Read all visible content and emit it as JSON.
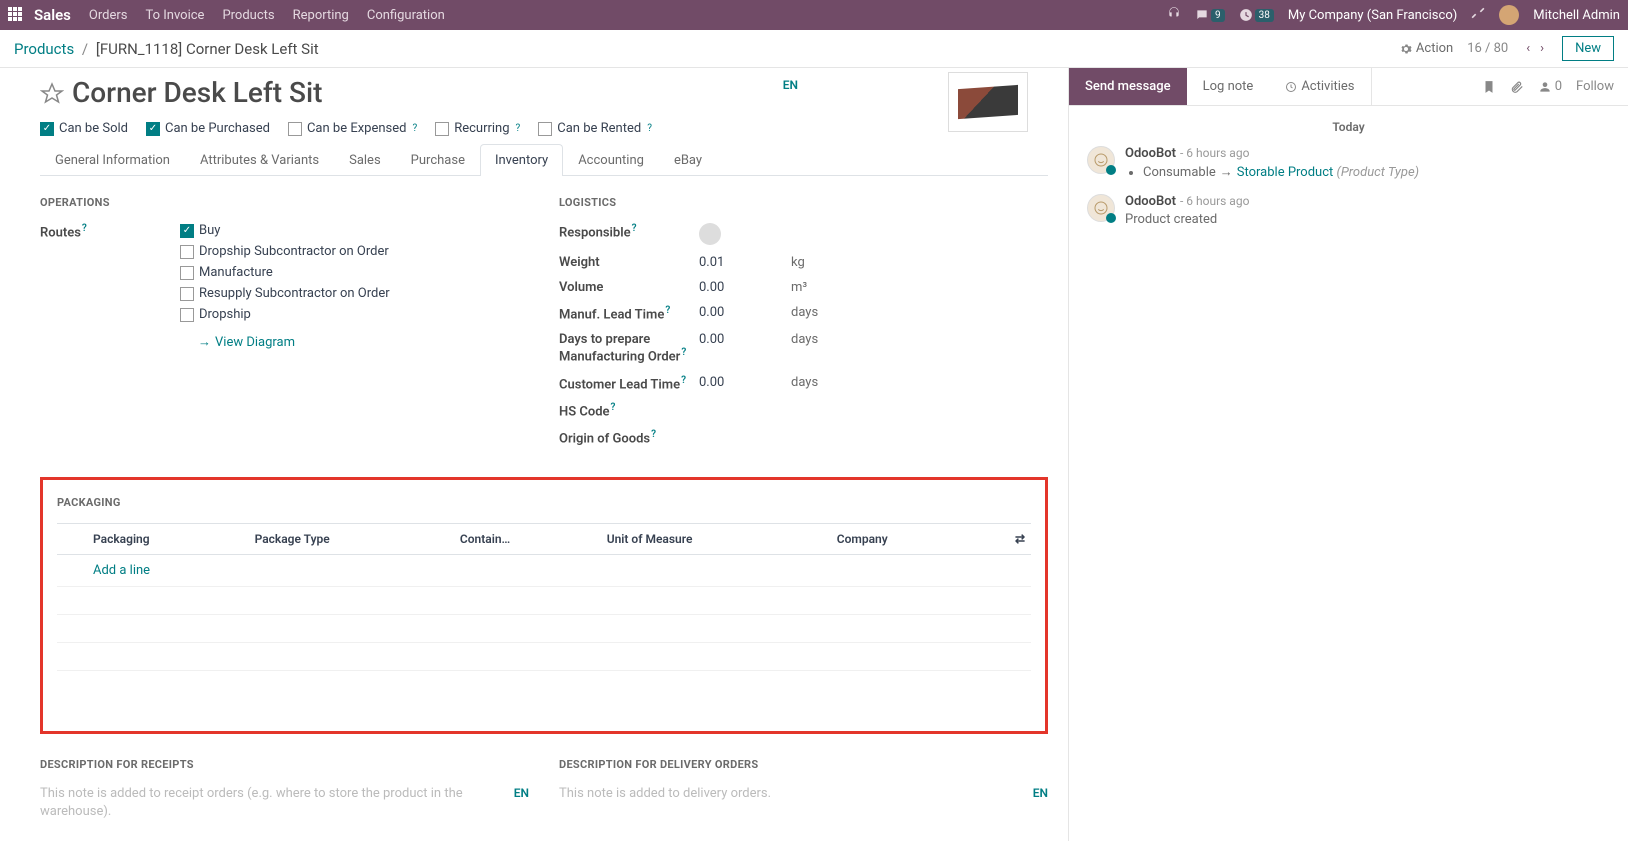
{
  "topbar": {
    "brand": "Sales",
    "menu": [
      "Orders",
      "To Invoice",
      "Products",
      "Reporting",
      "Configuration"
    ],
    "msg_badge": "9",
    "clock_badge": "38",
    "company": "My Company (San Francisco)",
    "user": "Mitchell Admin"
  },
  "breadcrumb": {
    "root": "Products",
    "current": "[FURN_1118] Corner Desk Left Sit"
  },
  "control": {
    "action": "Action",
    "pager": "16 / 80",
    "new": "New"
  },
  "title": "Corner Desk Left Sit",
  "lang": "EN",
  "checks": {
    "sold": "Can be Sold",
    "purchased": "Can be Purchased",
    "expensed": "Can be Expensed",
    "recurring": "Recurring",
    "rented": "Can be Rented"
  },
  "tabs": [
    "General Information",
    "Attributes & Variants",
    "Sales",
    "Purchase",
    "Inventory",
    "Accounting",
    "eBay"
  ],
  "active_tab": 4,
  "operations": {
    "title": "OPERATIONS",
    "routes_label": "Routes",
    "routes": [
      {
        "label": "Buy",
        "checked": true
      },
      {
        "label": "Dropship Subcontractor on Order",
        "checked": false
      },
      {
        "label": "Manufacture",
        "checked": false
      },
      {
        "label": "Resupply Subcontractor on Order",
        "checked": false
      },
      {
        "label": "Dropship",
        "checked": false
      }
    ],
    "view_diagram": "View Diagram"
  },
  "logistics": {
    "title": "LOGISTICS",
    "fields": {
      "responsible": "Responsible",
      "weight": "Weight",
      "weight_val": "0.01",
      "weight_unit": "kg",
      "volume": "Volume",
      "volume_val": "0.00",
      "volume_unit": "m³",
      "mlt": "Manuf. Lead Time",
      "mlt_val": "0.00",
      "mlt_unit": "days",
      "dpmo": "Days to prepare Manufacturing Order",
      "dpmo_val": "0.00",
      "dpmo_unit": "days",
      "clt": "Customer Lead Time",
      "clt_val": "0.00",
      "clt_unit": "days",
      "hs": "HS Code",
      "origin": "Origin of Goods"
    }
  },
  "packaging": {
    "title": "PACKAGING",
    "cols": [
      "Packaging",
      "Package Type",
      "Contain…",
      "Unit of Measure",
      "Company"
    ],
    "add_line": "Add a line"
  },
  "descriptions": {
    "receipts_title": "DESCRIPTION FOR RECEIPTS",
    "receipts_placeholder": "This note is added to receipt orders (e.g. where to store the product in the warehouse).",
    "delivery_title": "DESCRIPTION FOR DELIVERY ORDERS",
    "delivery_placeholder": "This note is added to delivery orders.",
    "lang": "EN"
  },
  "chatter": {
    "send": "Send message",
    "log": "Log note",
    "activities": "Activities",
    "follower_count": "0",
    "follow": "Follow",
    "today": "Today",
    "messages": [
      {
        "author": "OdooBot",
        "time": "6 hours ago",
        "bullets": [
          {
            "old": "Consumable",
            "new": "Storable Product",
            "tag": "(Product Type)"
          }
        ]
      },
      {
        "author": "OdooBot",
        "time": "6 hours ago",
        "text": "Product created"
      }
    ]
  }
}
